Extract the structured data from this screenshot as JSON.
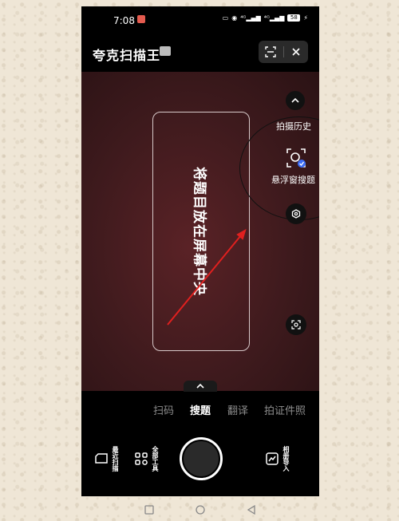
{
  "status_bar": {
    "time": "7:08",
    "notification_badge": "",
    "network_labels": [
      "⁴ᴳ",
      "⁴ᴳ"
    ],
    "battery": "58"
  },
  "header": {
    "app_title": "夸克扫描王",
    "scan_icon": "scan-frame-icon",
    "close_icon": "close-icon"
  },
  "camera": {
    "hint_text": "将题目放在屏幕中央",
    "side": {
      "history_label": "拍摄历史",
      "float_search_label": "悬浮窗搜题"
    }
  },
  "mode_tabs": [
    {
      "label": "扫码",
      "active": false
    },
    {
      "label": "搜题",
      "active": true
    },
    {
      "label": "翻译",
      "active": false
    },
    {
      "label": "拍证件照",
      "active": false
    }
  ],
  "bottom_tools": {
    "recent_scans": "最近扫描",
    "all_tools": "全部工具",
    "album_import": "相册导入"
  },
  "colors": {
    "accent_arrow": "#e0201f",
    "camera_bg": "#3e1a1d",
    "badge_blue": "#3b6cf5"
  }
}
